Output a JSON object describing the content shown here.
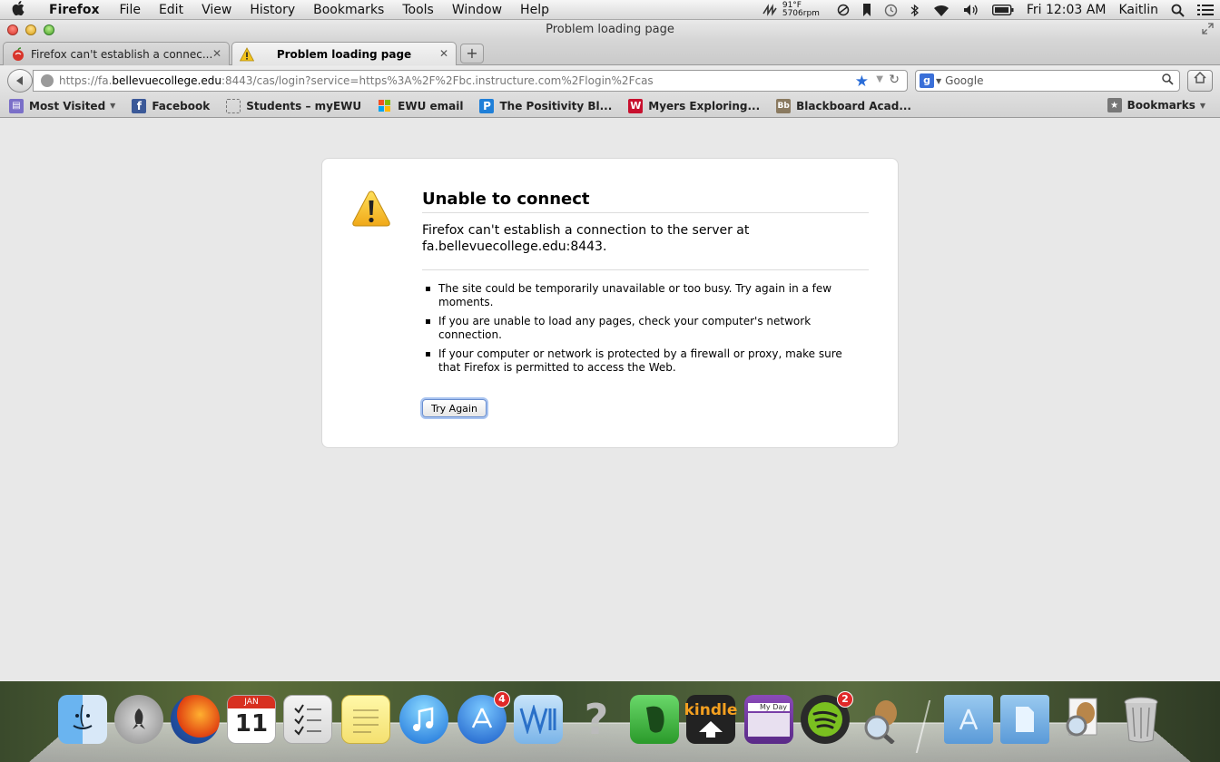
{
  "menubar": {
    "apple": "",
    "app_name": "Firefox",
    "menus": [
      "File",
      "Edit",
      "View",
      "History",
      "Bookmarks",
      "Tools",
      "Window",
      "Help"
    ],
    "temp": "91°F",
    "fan": "5706rpm",
    "clock": "Fri 12:03 AM",
    "user": "Kaitlin"
  },
  "window": {
    "title": "Problem loading page"
  },
  "tabs": [
    {
      "label": "Firefox can't establish a connec...",
      "close": "✕"
    },
    {
      "label": "Problem loading page",
      "close": "✕"
    }
  ],
  "newtab": "+",
  "navbar": {
    "url_prefix": "https://fa.",
    "url_domain": "bellevuecollege.edu",
    "url_suffix": ":8443/cas/login?service=https%3A%2F%2Fbc.instructure.com%2Flogin%2Fcas",
    "search_placeholder": "Google"
  },
  "bookmarks": [
    {
      "label": "Most Visited",
      "icon": "most-visited-icon",
      "color": "#6f6fc8"
    },
    {
      "label": "Facebook",
      "icon": "facebook-icon",
      "color": "#3b5998"
    },
    {
      "label": "Students – myEWU",
      "icon": "dashed-page-icon",
      "color": "#ffffff"
    },
    {
      "label": "EWU email",
      "icon": "windows-icon",
      "color": "#e05020"
    },
    {
      "label": "The Positivity Bl...",
      "icon": "p-icon",
      "color": "#1f7fd8"
    },
    {
      "label": "Myers Exploring...",
      "icon": "w-icon",
      "color": "#c8102e"
    },
    {
      "label": "Blackboard Acad...",
      "icon": "bb-icon",
      "color": "#8a7a60"
    }
  ],
  "bookmarks_menu": "Bookmarks",
  "error": {
    "title": "Unable to connect",
    "desc_line1": "Firefox can't establish a connection to the server at",
    "desc_line2": "fa.bellevuecollege.edu:8443.",
    "items": [
      "The site could be temporarily unavailable or too busy. Try again in a few moments.",
      "If you are unable to load any pages, check your computer's network connection.",
      "If your computer or network is protected by a firewall or proxy, make sure that Firefox is permitted to access the Web."
    ],
    "button": "Try Again"
  },
  "dock": {
    "calendar_month": "JAN",
    "calendar_day": "11",
    "appstore_badge": "4",
    "spotify_badge": "2",
    "kindle_label": "kindle",
    "myday_label": "My Day",
    "help_label": "?"
  }
}
